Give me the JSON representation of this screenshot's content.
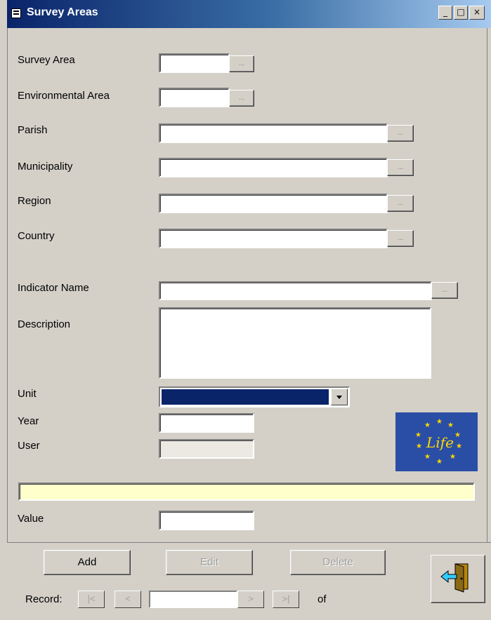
{
  "window": {
    "title": "Survey Areas",
    "minimize": "_",
    "maximize": "□",
    "close": "×"
  },
  "fields": {
    "survey_area": {
      "label": "Survey Area",
      "value": ""
    },
    "environmental_area": {
      "label": "Environmental Area",
      "value": ""
    },
    "parish": {
      "label": "Parish",
      "value": ""
    },
    "municipality": {
      "label": "Municipality",
      "value": ""
    },
    "region": {
      "label": "Region",
      "value": ""
    },
    "country": {
      "label": "Country",
      "value": ""
    },
    "indicator_name": {
      "label": "Indicator Name",
      "value": ""
    },
    "description": {
      "label": "Description",
      "value": ""
    },
    "unit": {
      "label": "Unit",
      "value": ""
    },
    "year": {
      "label": "Year",
      "value": ""
    },
    "user": {
      "label": "User",
      "value": ""
    },
    "value": {
      "label": "Value",
      "value": ""
    }
  },
  "ellipsis": "...",
  "logo": {
    "text": "Life",
    "colors": {
      "background": "#2a4ea6",
      "stars": "#ffd700"
    }
  },
  "buttons": {
    "add": "Add",
    "edit": "Edit",
    "delete": "Delete"
  },
  "navigation": {
    "record_label": "Record:",
    "first": "|<",
    "prev": "<",
    "next": ">",
    "last": ">|",
    "of_label": "of",
    "current": ""
  },
  "icons": {
    "exit": "exit-door-icon",
    "form": "form-icon"
  },
  "colors": {
    "window_bg": "#d4d0c8",
    "title_bar": "#0a246a",
    "selection": "#0a246a",
    "status_field": "#ffffcc"
  }
}
